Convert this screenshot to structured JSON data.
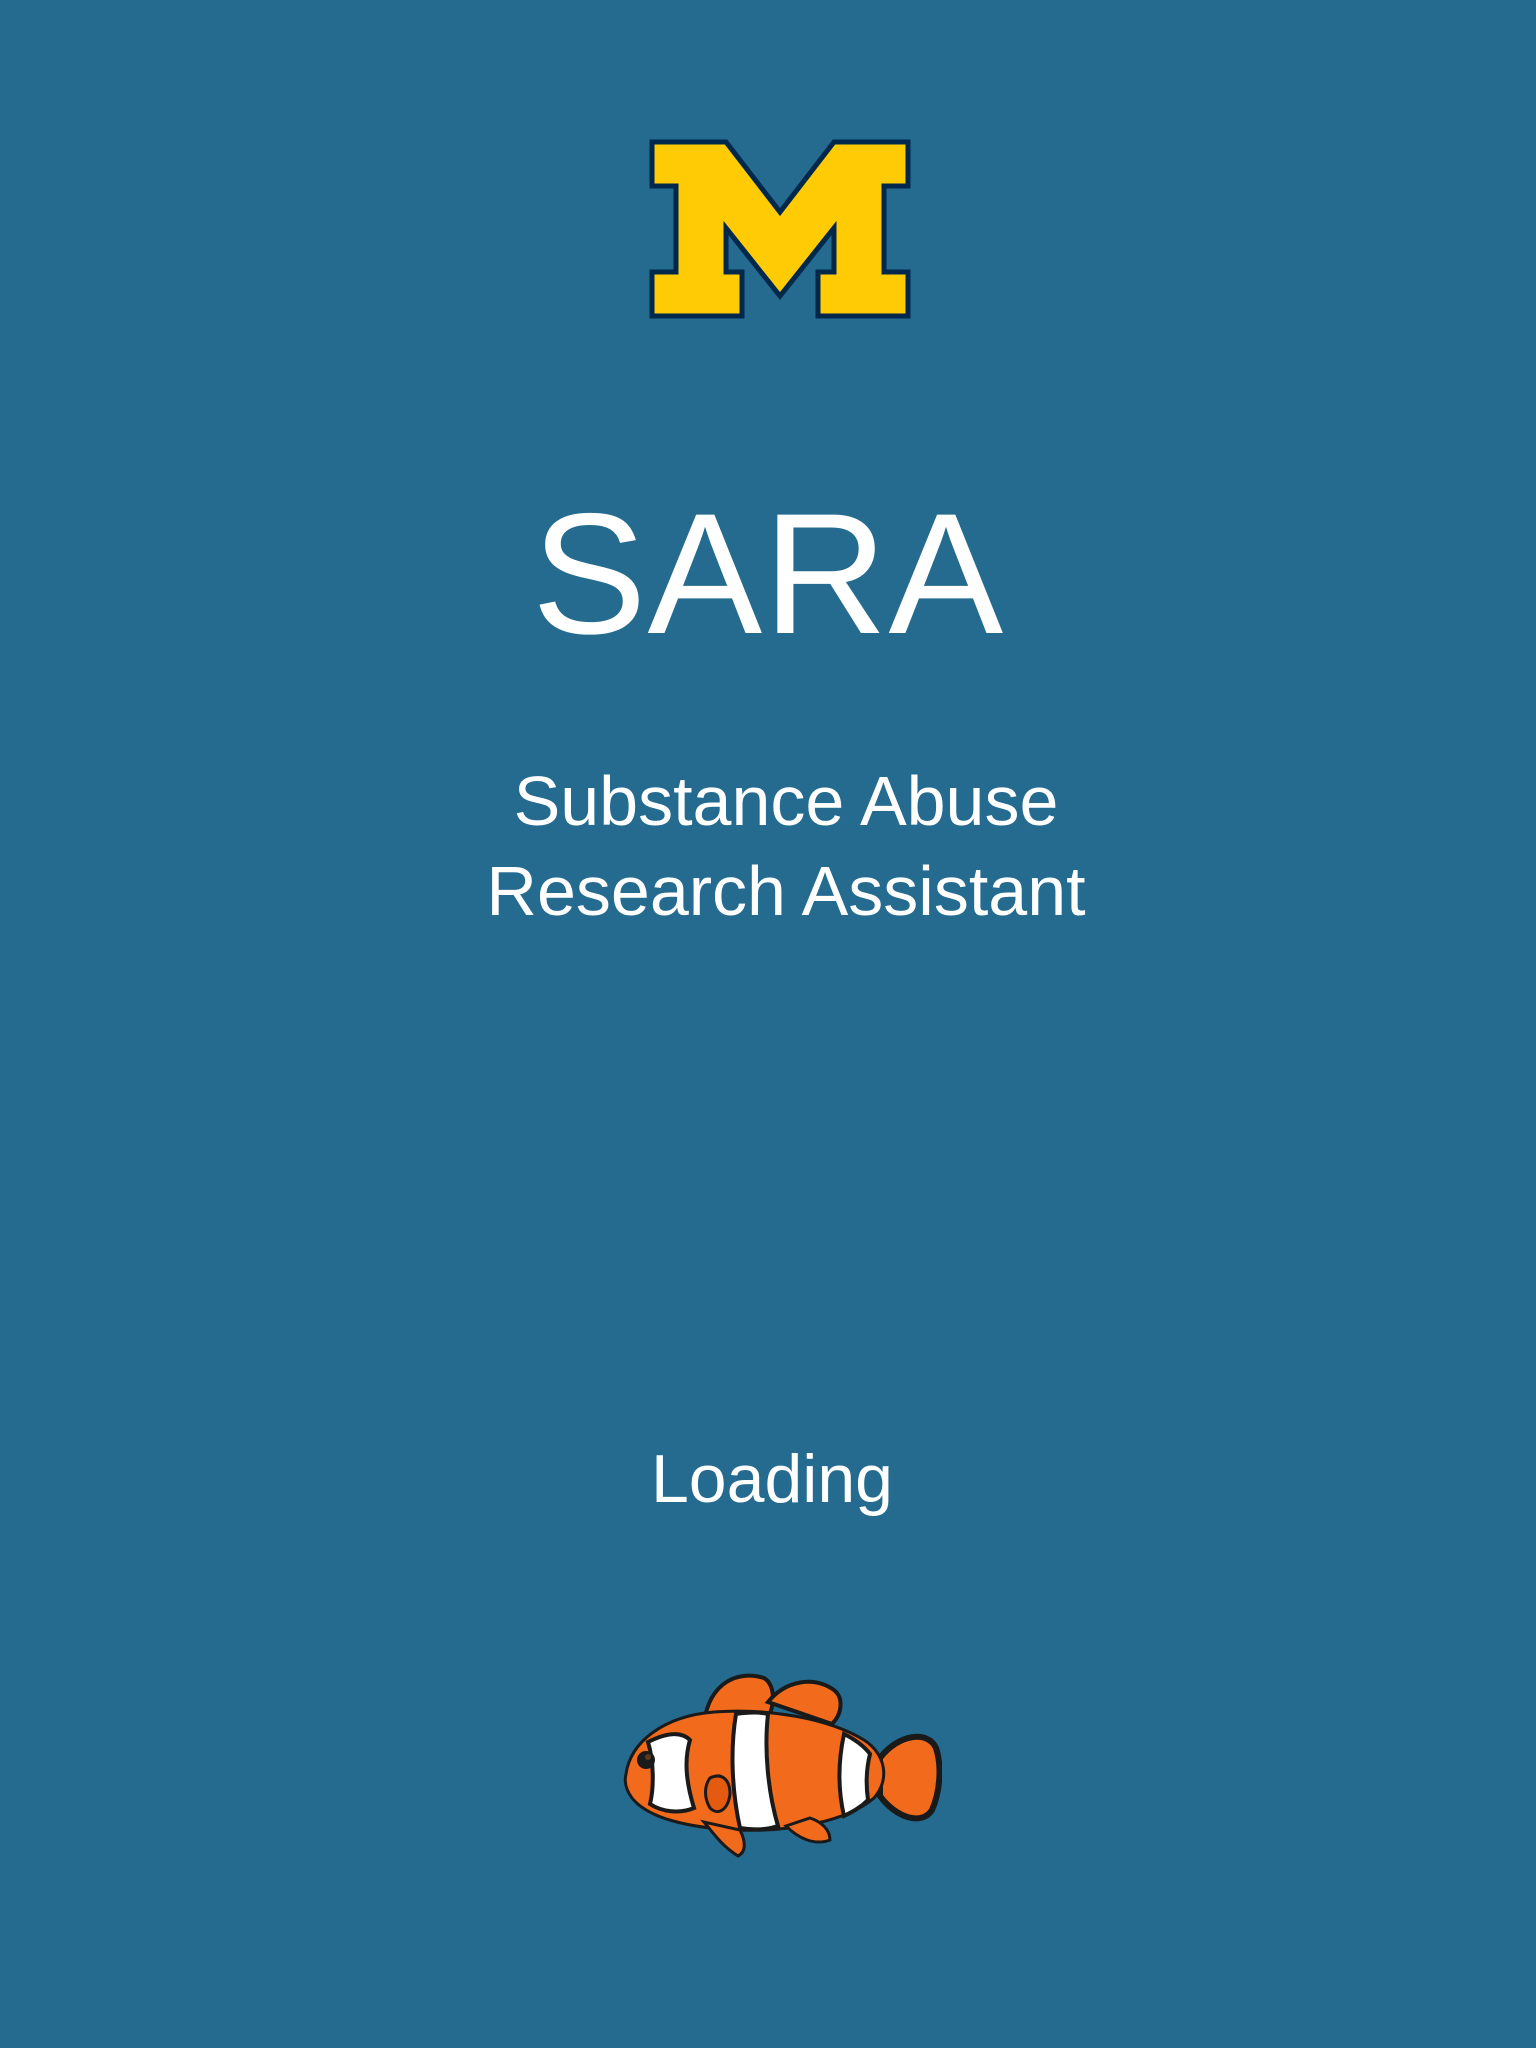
{
  "app": {
    "name": "SARA",
    "subtitle_line1": "Substance Abuse",
    "subtitle_line2": "Research Assistant",
    "status": "Loading"
  },
  "icons": {
    "logo": "university-block-m-logo",
    "mascot": "clownfish-icon"
  },
  "colors": {
    "background": "#246B8F",
    "text": "#FFFFFF",
    "logo_fill": "#FFCB05",
    "logo_outline": "#00274C",
    "fish_orange": "#F26A1B",
    "fish_stripe": "#FFFFFF",
    "fish_dark": "#1A1A1A"
  }
}
